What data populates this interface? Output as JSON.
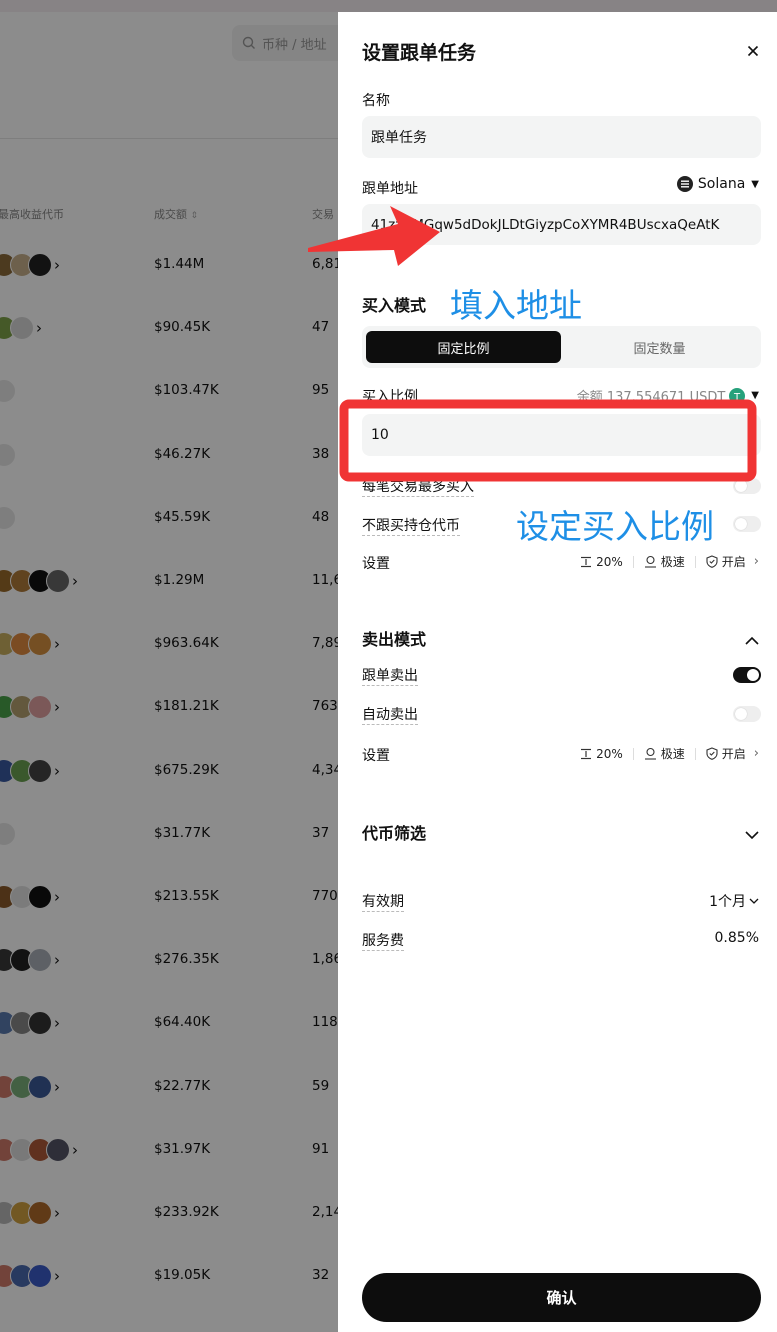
{
  "background": {
    "search_placeholder": "币种 / 地址",
    "col_token": "最高收益代币",
    "col_volume": "成交额",
    "col_trades": "交易",
    "rows": [
      {
        "volume": "$1.44M",
        "trades": "6,81",
        "coins": [
          "#8a6a3a",
          "#c7b08a",
          "#222222"
        ],
        "more": true
      },
      {
        "volume": "$90.45K",
        "trades": "47",
        "coins": [
          "#7fa34a",
          "#d8d8d8"
        ],
        "more": true
      },
      {
        "volume": "$103.47K",
        "trades": "95",
        "coins": [
          "#e6e6e6"
        ],
        "more": false
      },
      {
        "volume": "$46.27K",
        "trades": "38",
        "coins": [
          "#e6e6e6"
        ],
        "more": false
      },
      {
        "volume": "$45.59K",
        "trades": "48",
        "coins": [
          "#e6e6e6"
        ],
        "more": false
      },
      {
        "volume": "$1.29M",
        "trades": "11,6",
        "coins": [
          "#9a6a2a",
          "#b07a3a",
          "#111111",
          "#666666"
        ],
        "more": true
      },
      {
        "volume": "$963.64K",
        "trades": "7,89",
        "coins": [
          "#c8b060",
          "#e08a40",
          "#d69040"
        ],
        "more": true
      },
      {
        "volume": "$181.21K",
        "trades": "763",
        "coins": [
          "#4aa34a",
          "#b5a070",
          "#e0a0a0"
        ],
        "more": true
      },
      {
        "volume": "$675.29K",
        "trades": "4,34",
        "coins": [
          "#3a5aa0",
          "#6aa050",
          "#444444"
        ],
        "more": true
      },
      {
        "volume": "$31.77K",
        "trades": "37",
        "coins": [
          "#e6e6e6"
        ],
        "more": false
      },
      {
        "volume": "$213.55K",
        "trades": "770",
        "coins": [
          "#8a5a2a",
          "#e0e0e0",
          "#111111"
        ],
        "more": true
      },
      {
        "volume": "$276.35K",
        "trades": "1,86",
        "coins": [
          "#3a3a3a",
          "#222222",
          "#aab0b8"
        ],
        "more": true
      },
      {
        "volume": "$64.40K",
        "trades": "118",
        "coins": [
          "#5a7ab0",
          "#888888",
          "#333333"
        ],
        "more": true
      },
      {
        "volume": "$22.77K",
        "trades": "59",
        "coins": [
          "#d07a6a",
          "#7ab07a",
          "#3b5998"
        ],
        "more": true
      },
      {
        "volume": "$31.97K",
        "trades": "91",
        "coins": [
          "#d07a6a",
          "#ddd",
          "#b05a3a",
          "#556"
        ],
        "more": true
      },
      {
        "volume": "$233.92K",
        "trades": "2,14",
        "coins": [
          "#b8b8b8",
          "#d0a040",
          "#b06a2a"
        ],
        "more": true
      },
      {
        "volume": "$19.05K",
        "trades": "32",
        "coins": [
          "#d07a6a",
          "#4a6ab0",
          "#3b5cc8"
        ],
        "more": true
      }
    ]
  },
  "drawer": {
    "title": "设置跟单任务",
    "name_label": "名称",
    "name_value": "跟单任务",
    "address_label": "跟单地址",
    "chain": "Solana",
    "address_value": "41zzUMGqw5dDokJLDtGiyzpCoXYMR4BUscxaQeAtK",
    "buy_mode_label": "买入模式",
    "buy_mode_tabs": [
      "固定比例",
      "固定数量"
    ],
    "buy_ratio_label": "买入比例",
    "balance": "余额 137.554671 USDT",
    "buy_ratio_value": "10",
    "max_buy_label": "每笔交易最多买入",
    "no_follow_label": "不跟买持仓代币",
    "settings_label": "设置",
    "slippage": "20%",
    "speed": "极速",
    "protection": "开启",
    "sell_mode_label": "卖出模式",
    "follow_sell_label": "跟单卖出",
    "follow_sell_on": true,
    "auto_sell_label": "自动卖出",
    "auto_sell_on": false,
    "sell_settings_label": "设置",
    "sell_slippage": "20%",
    "sell_speed": "极速",
    "sell_protection": "开启",
    "token_filter_label": "代币筛选",
    "validity_label": "有效期",
    "validity_value": "1个月",
    "fee_label": "服务费",
    "fee_value": "0.85%",
    "confirm_label": "确认"
  },
  "annotations": {
    "fill_address": "填入地址",
    "set_ratio": "设定买入比例"
  },
  "colors": {
    "annotation_red": "#f03434",
    "annotation_blue": "#1e8fe6",
    "accent": "#111111"
  }
}
